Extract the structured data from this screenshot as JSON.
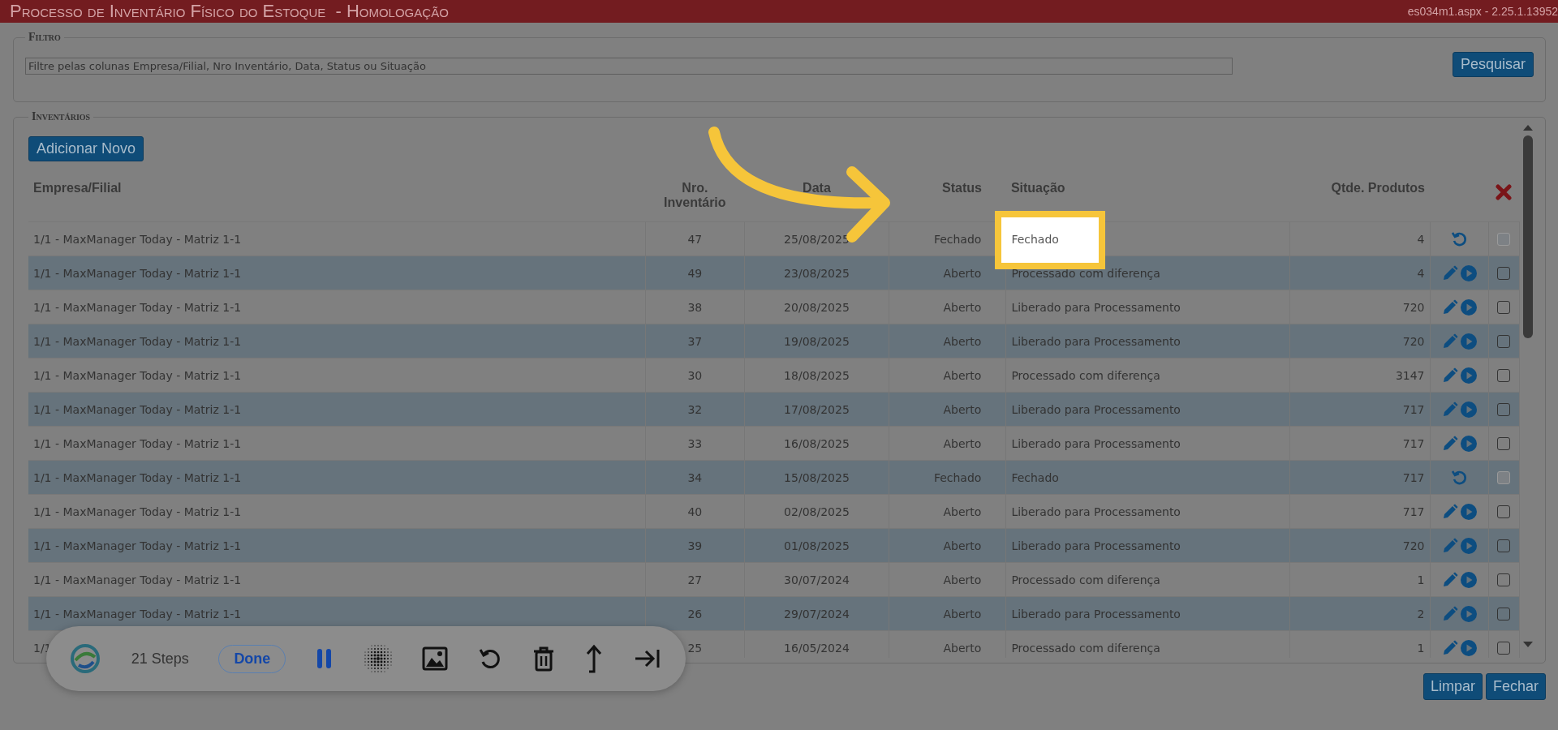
{
  "window": {
    "title": "Processo de Inventário Físico do Estoque  - Homologação",
    "version": "es034m1.aspx - 2.25.1.13952"
  },
  "filter": {
    "legend": "Filtro",
    "placeholder": "Filtre pelas colunas Empresa/Filial, Nro Inventário, Data, Status ou Situação",
    "button": "Pesquisar"
  },
  "inventories": {
    "legend": "Inventários",
    "add_button": "Adicionar Novo",
    "columns": [
      "Empresa/Filial",
      "Nro. Inventário",
      "Data",
      "Status",
      "Situação",
      "Qtde. Produtos"
    ],
    "rows": [
      {
        "empresa": "1/1 - MaxManager Today - Matriz 1-1",
        "nro": "47",
        "data": "25/08/2025",
        "status": "Fechado",
        "situacao": "Fechado",
        "qtde": "4",
        "kind": "closed",
        "checked": false,
        "disabled": true,
        "spotlit": true
      },
      {
        "empresa": "1/1 - MaxManager Today - Matriz 1-1",
        "nro": "49",
        "data": "23/08/2025",
        "status": "Aberto",
        "situacao": "Processado com diferença",
        "qtde": "4",
        "kind": "open",
        "checked": false,
        "disabled": false,
        "spotlit": false
      },
      {
        "empresa": "1/1 - MaxManager Today - Matriz 1-1",
        "nro": "38",
        "data": "20/08/2025",
        "status": "Aberto",
        "situacao": "Liberado para Processamento",
        "qtde": "720",
        "kind": "open",
        "checked": false,
        "disabled": false,
        "spotlit": false
      },
      {
        "empresa": "1/1 - MaxManager Today - Matriz 1-1",
        "nro": "37",
        "data": "19/08/2025",
        "status": "Aberto",
        "situacao": "Liberado para Processamento",
        "qtde": "720",
        "kind": "open",
        "checked": false,
        "disabled": false,
        "spotlit": false
      },
      {
        "empresa": "1/1 - MaxManager Today - Matriz 1-1",
        "nro": "30",
        "data": "18/08/2025",
        "status": "Aberto",
        "situacao": "Processado com diferença",
        "qtde": "3147",
        "kind": "open",
        "checked": false,
        "disabled": false,
        "spotlit": false
      },
      {
        "empresa": "1/1 - MaxManager Today - Matriz 1-1",
        "nro": "32",
        "data": "17/08/2025",
        "status": "Aberto",
        "situacao": "Liberado para Processamento",
        "qtde": "717",
        "kind": "open",
        "checked": false,
        "disabled": false,
        "spotlit": false
      },
      {
        "empresa": "1/1 - MaxManager Today - Matriz 1-1",
        "nro": "33",
        "data": "16/08/2025",
        "status": "Aberto",
        "situacao": "Liberado para Processamento",
        "qtde": "717",
        "kind": "open",
        "checked": false,
        "disabled": false,
        "spotlit": false
      },
      {
        "empresa": "1/1 - MaxManager Today - Matriz 1-1",
        "nro": "34",
        "data": "15/08/2025",
        "status": "Fechado",
        "situacao": "Fechado",
        "qtde": "717",
        "kind": "closed",
        "checked": false,
        "disabled": true,
        "spotlit": false
      },
      {
        "empresa": "1/1 - MaxManager Today - Matriz 1-1",
        "nro": "40",
        "data": "02/08/2025",
        "status": "Aberto",
        "situacao": "Liberado para Processamento",
        "qtde": "717",
        "kind": "open",
        "checked": false,
        "disabled": false,
        "spotlit": false
      },
      {
        "empresa": "1/1 - MaxManager Today - Matriz 1-1",
        "nro": "39",
        "data": "01/08/2025",
        "status": "Aberto",
        "situacao": "Liberado para Processamento",
        "qtde": "720",
        "kind": "open",
        "checked": false,
        "disabled": false,
        "spotlit": false
      },
      {
        "empresa": "1/1 - MaxManager Today - Matriz 1-1",
        "nro": "27",
        "data": "30/07/2024",
        "status": "Aberto",
        "situacao": "Processado com diferença",
        "qtde": "1",
        "kind": "open",
        "checked": false,
        "disabled": false,
        "spotlit": false
      },
      {
        "empresa": "1/1 - MaxManager Today - Matriz 1-1",
        "nro": "26",
        "data": "29/07/2024",
        "status": "Aberto",
        "situacao": "Liberado para Processamento",
        "qtde": "2",
        "kind": "open",
        "checked": false,
        "disabled": false,
        "spotlit": false
      },
      {
        "empresa": "1/1",
        "nro": "25",
        "data": "16/05/2024",
        "status": "Aberto",
        "situacao": "Processado com diferença",
        "qtde": "1",
        "kind": "open",
        "checked": false,
        "disabled": false,
        "spotlit": false
      }
    ]
  },
  "footer_buttons": [
    "Limpar",
    "Fechar"
  ],
  "recorder": {
    "steps": "21 Steps",
    "done": "Done"
  }
}
